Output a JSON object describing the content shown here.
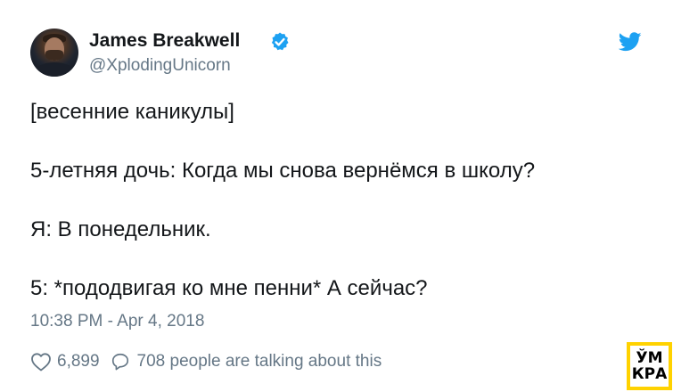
{
  "author": {
    "display_name": "James Breakwell",
    "handle": "@XplodingUnicorn",
    "verified": true,
    "avatar": "avatar-photo"
  },
  "tweet": {
    "lines": [
      "[весенние каникулы]",
      "5-летняя дочь: Когда мы снова вернёмся в школу?",
      "Я: В понедельник.",
      "5: *пододвигая ко мне пенни* А сейчас?"
    ],
    "timestamp": "10:38 PM - Apr 4, 2018"
  },
  "actions": {
    "likes": "6,899",
    "talking": "708 people are talking about this"
  },
  "watermark": {
    "line1": "ЎМ",
    "line2": "КРА"
  },
  "icons": {
    "like": "heart-icon",
    "reply": "reply-icon",
    "verified": "verified-badge-icon",
    "brand": "twitter-bird-icon"
  },
  "colors": {
    "twitter_blue": "#1da1f2",
    "text_primary": "#14171a",
    "text_secondary": "#657786",
    "watermark_yellow": "#ffd200"
  }
}
